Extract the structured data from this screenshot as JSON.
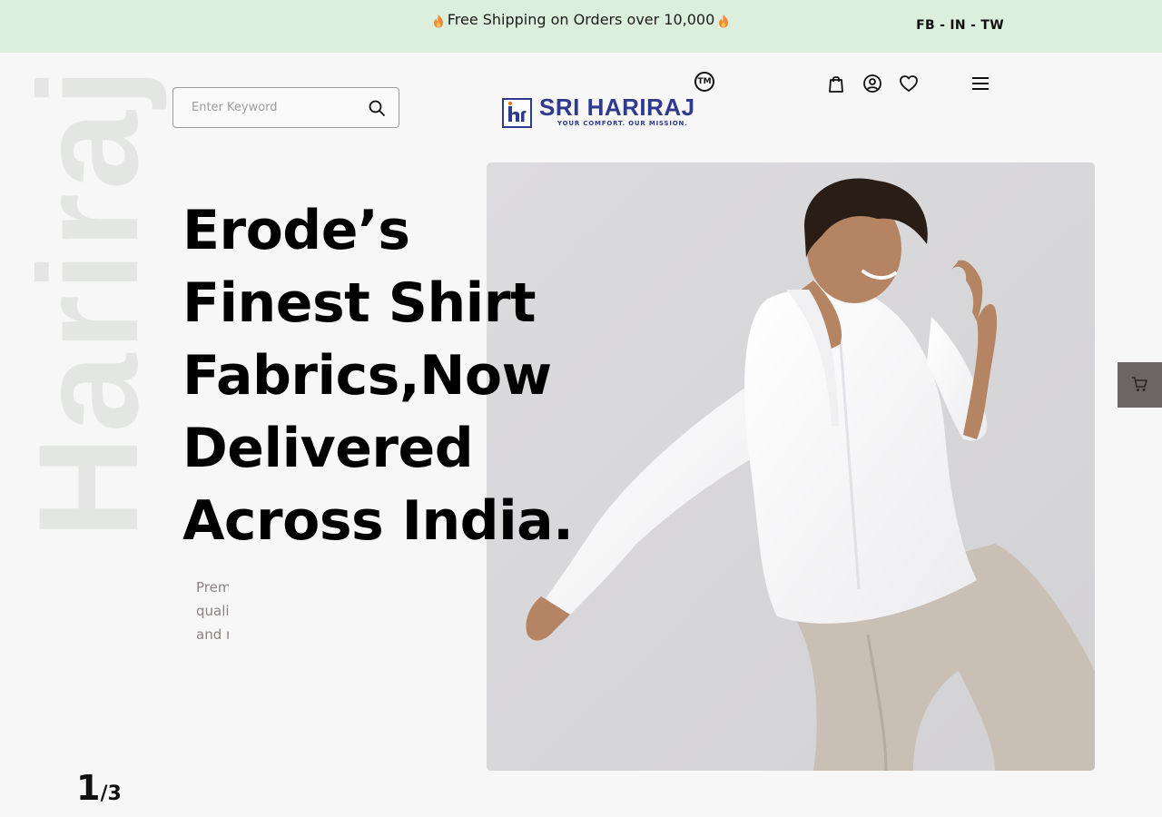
{
  "topbar": {
    "announcement": "Free Shipping on Orders over 10,000",
    "social": "FB - IN - TW",
    "colors": {
      "background": "#dcefdc"
    }
  },
  "watermark": "Hariraj",
  "search": {
    "placeholder": "Enter Keyword",
    "value": "",
    "icon": "search-icon"
  },
  "logo": {
    "mark": "hr",
    "name": "SRI HARIRAJ",
    "tagline": "YOUR COMFORT. OUR MISSION.",
    "tm": "TM",
    "color": "#2f3a8f"
  },
  "header_icons": [
    "shopping-bag-icon",
    "user-icon",
    "heart-icon",
    "menu-icon"
  ],
  "hero": {
    "headline_lines": [
      "Erode’s",
      "Finest Shirt",
      "Fabrics,Now",
      "Delivered",
      "Across India."
    ],
    "subtext_lines": [
      "Prem",
      "qualit",
      "and m"
    ],
    "slide_current": "1",
    "slide_separator": "/",
    "slide_total": "3"
  },
  "floating_cart": {
    "icon": "cart-icon",
    "color": "#6b6563"
  }
}
